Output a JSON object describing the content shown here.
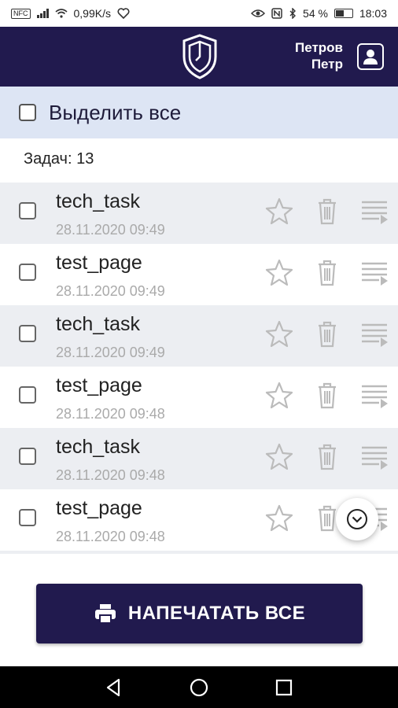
{
  "status_bar": {
    "carrier_badge": "NFC",
    "speed": "0,99K/s",
    "battery_percent": "54 %",
    "time": "18:03"
  },
  "header": {
    "user_last_name": "Петров",
    "user_first_name": "Петр",
    "logo_icon": "shield-logo-icon",
    "user_icon": "person-icon"
  },
  "select_all": {
    "label": "Выделить все",
    "checked": false
  },
  "task_count": "Задач: 13",
  "tasks": [
    {
      "title": "tech_task",
      "date": "28.11.2020 09:49"
    },
    {
      "title": "test_page",
      "date": "28.11.2020 09:49"
    },
    {
      "title": "tech_task",
      "date": "28.11.2020 09:49"
    },
    {
      "title": "test_page",
      "date": "28.11.2020 09:48"
    },
    {
      "title": "tech_task",
      "date": "28.11.2020 09:48"
    },
    {
      "title": "test_page",
      "date": "28.11.2020 09:48"
    }
  ],
  "print_all_label": "НАПЕЧАТАТЬ ВСЕ",
  "colors": {
    "primary": "#211a4e",
    "select_all_bg": "#dde5f4",
    "row_alt_bg": "#eceef2",
    "icon_gray": "#bbbbbb"
  }
}
